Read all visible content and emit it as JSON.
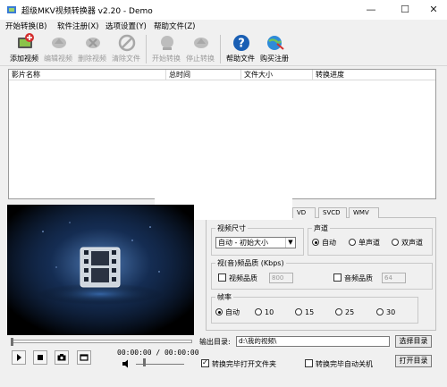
{
  "window": {
    "title": "超级MKV视频转换器 v2.20 - Demo",
    "minimize": "—",
    "maximize": "☐",
    "close": "✕"
  },
  "menu": [
    "开始转换(B)",
    "软件注册(X)",
    "选项设置(Y)",
    "帮助文件(Z)"
  ],
  "toolbar": {
    "add_video": "添加视频",
    "edit_video": "编辑视频",
    "delete_video": "删除视频",
    "clear_files": "清除文件",
    "start_convert": "开始转换",
    "stop_convert": "停止转换",
    "help_file": "帮助文件",
    "buy_register": "购买注册"
  },
  "file_list": {
    "columns": [
      "影片名称",
      "总时间",
      "文件大小",
      "转换进度"
    ]
  },
  "tabs": [
    "VD",
    "SVCD",
    "WMV"
  ],
  "settings": {
    "video_size": {
      "legend": "视频尺寸",
      "selected": "自动 - 初始大小"
    },
    "channel": {
      "legend": "声道",
      "options": [
        "自动",
        "单声道",
        "双声道"
      ],
      "selected": 0
    },
    "quality": {
      "legend": "视(音)频品质 (Kbps)",
      "video_label": "视频品质",
      "video_value": "800",
      "audio_label": "音频品质",
      "audio_value": "64"
    },
    "framerate": {
      "legend": "帧率",
      "options": [
        "自动",
        "10",
        "15",
        "25",
        "30"
      ],
      "selected": 0
    }
  },
  "player": {
    "time": "00:00:00 / 00:00:00",
    "progress": 0,
    "volume": 0.15
  },
  "output": {
    "label": "输出目录:",
    "path": "d:\\我的视频\\",
    "choose_button": "选择目录",
    "open_button": "打开目录",
    "open_after": "转换完毕打开文件夹",
    "open_after_checked": true,
    "shutdown_after": "转换完毕自动关机",
    "shutdown_after_checked": false
  },
  "colors": {
    "accent_blue": "#1a5fb4",
    "add_green": "#2f9a3a",
    "disabled_gray": "#9a9a9a"
  }
}
